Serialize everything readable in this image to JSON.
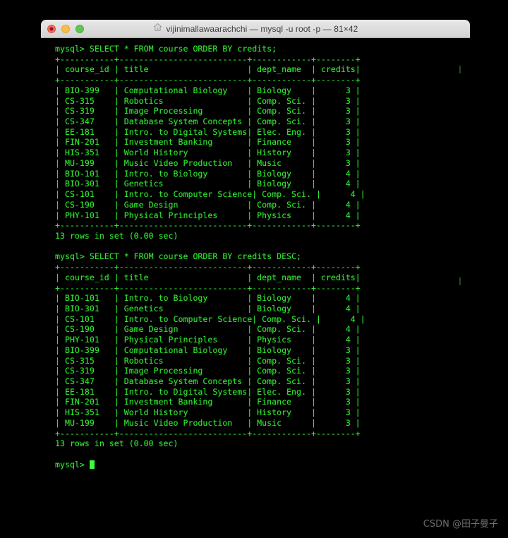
{
  "window": {
    "title": "vijinimallawaarachchi — mysql -u root -p — 81×42",
    "home_icon": "home-icon",
    "close_label": "",
    "minimize_label": "",
    "maximize_label": ""
  },
  "terminal": {
    "prompt": "mysql>",
    "columns": 81,
    "rows": 42,
    "foreground_color": "#2ee62e",
    "background_color": "#000000",
    "cursor": "block",
    "queries": [
      "SELECT * FROM course ORDER BY credits;",
      "SELECT * FROM course ORDER BY credits DESC;"
    ],
    "separator": "+------------+---------------------------+-------------+---------+",
    "status": "13 rows in set (0.00 sec)",
    "columns_header": [
      "course_id",
      "title",
      "dept_name",
      "credits"
    ],
    "result_1": {
      "query": "SELECT * FROM course ORDER BY credits;",
      "status": "13 rows in set (0.00 sec)",
      "rows": [
        [
          "BIO-399",
          "Computational Biology",
          "Biology",
          "3"
        ],
        [
          "CS-315",
          "Robotics",
          "Comp. Sci.",
          "3"
        ],
        [
          "CS-319",
          "Image Processing",
          "Comp. Sci.",
          "3"
        ],
        [
          "CS-347",
          "Database System Concepts",
          "Comp. Sci.",
          "3"
        ],
        [
          "EE-181",
          "Intro. to Digital Systems",
          "Elec. Eng.",
          "3"
        ],
        [
          "FIN-201",
          "Investment Banking",
          "Finance",
          "3"
        ],
        [
          "HIS-351",
          "World History",
          "History",
          "3"
        ],
        [
          "MU-199",
          "Music Video Production",
          "Music",
          "3"
        ],
        [
          "BIO-101",
          "Intro. to Biology",
          "Biology",
          "4"
        ],
        [
          "BIO-301",
          "Genetics",
          "Biology",
          "4"
        ],
        [
          "CS-101",
          "Intro. to Computer Science",
          "Comp. Sci.",
          "4"
        ],
        [
          "CS-190",
          "Game Design",
          "Comp. Sci.",
          "4"
        ],
        [
          "PHY-101",
          "Physical Principles",
          "Physics",
          "4"
        ]
      ]
    },
    "result_2": {
      "query": "SELECT * FROM course ORDER BY credits DESC;",
      "status": "13 rows in set (0.00 sec)",
      "rows": [
        [
          "BIO-101",
          "Intro. to Biology",
          "Biology",
          "4"
        ],
        [
          "BIO-301",
          "Genetics",
          "Biology",
          "4"
        ],
        [
          "CS-101",
          "Intro. to Computer Science",
          "Comp. Sci.",
          "4"
        ],
        [
          "CS-190",
          "Game Design",
          "Comp. Sci.",
          "4"
        ],
        [
          "PHY-101",
          "Physical Principles",
          "Physics",
          "4"
        ],
        [
          "BIO-399",
          "Computational Biology",
          "Biology",
          "3"
        ],
        [
          "CS-315",
          "Robotics",
          "Comp. Sci.",
          "3"
        ],
        [
          "CS-319",
          "Image Processing",
          "Comp. Sci.",
          "3"
        ],
        [
          "CS-347",
          "Database System Concepts",
          "Comp. Sci.",
          "3"
        ],
        [
          "EE-181",
          "Intro. to Digital Systems",
          "Elec. Eng.",
          "3"
        ],
        [
          "FIN-201",
          "Investment Banking",
          "Finance",
          "3"
        ],
        [
          "HIS-351",
          "World History",
          "History",
          "3"
        ],
        [
          "MU-199",
          "Music Video Production",
          "Music",
          "3"
        ]
      ]
    }
  },
  "watermark": {
    "text": "CSDN @田子曼子"
  }
}
